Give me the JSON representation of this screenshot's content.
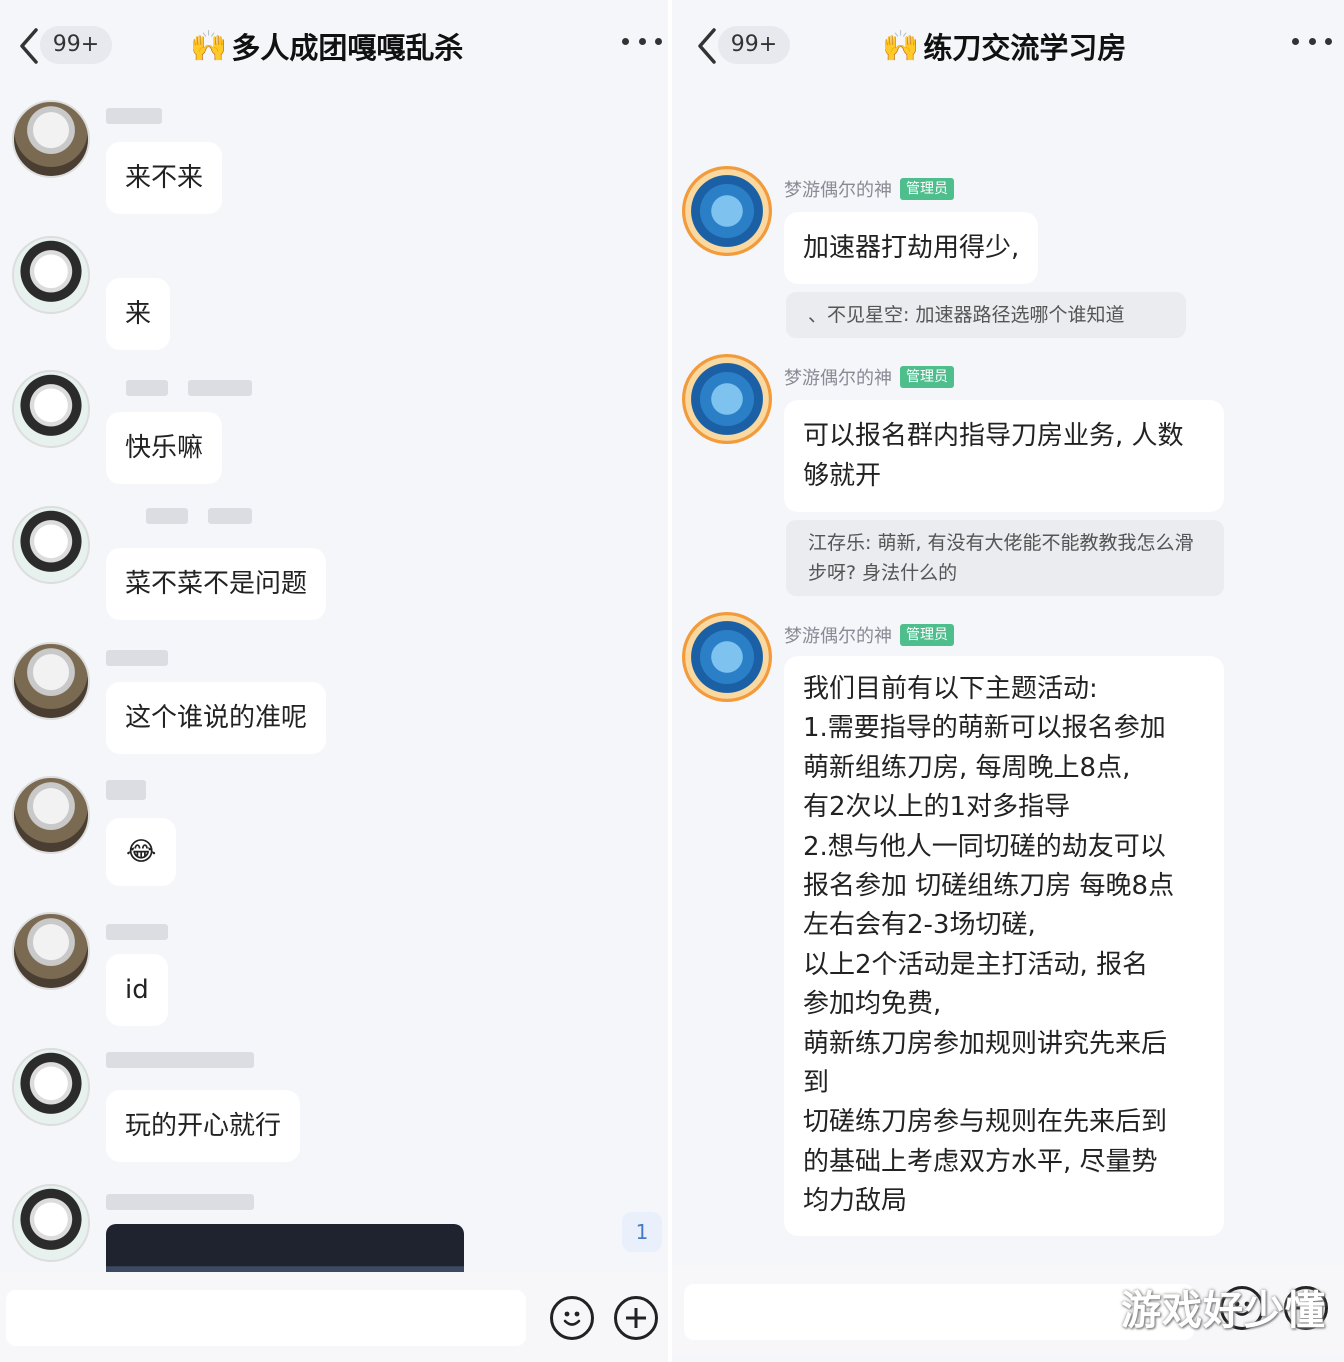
{
  "left_chat": {
    "unread_badge": "99+",
    "title_emoji": "🙌",
    "title": "多人成团嘎嘎乱杀",
    "messages": [
      {
        "text": "来不来"
      },
      {
        "text": "来"
      },
      {
        "text": "快乐嘛"
      },
      {
        "text": "菜不菜不是问题"
      },
      {
        "text": "这个谁说的准呢"
      },
      {
        "text": "😂"
      },
      {
        "text": "id"
      },
      {
        "text": "玩的开心就行"
      }
    ],
    "new_message_count": "1",
    "emoji_icon": "smiley-icon",
    "plus_icon": "plus-icon"
  },
  "right_chat": {
    "unread_badge": "99+",
    "title_emoji": "🙌",
    "title": "练刀交流学习房",
    "sender_name": "梦游偶尔的神",
    "admin_tag": "管理员",
    "messages": [
      {
        "text": "加速器打劫用得少,",
        "quote": "、不见星空: 加速器路径选哪个谁知道"
      },
      {
        "text": "可以报名群内指导刀房业务, 人数够就开",
        "quote": "江存乐: 萌新, 有没有大佬能不能教教我怎么滑步呀? 身法什么的"
      },
      {
        "lines": [
          "我们目前有以下主题活动:",
          "1.需要指导的萌新可以报名参加",
          "萌新组练刀房, 每周晚上8点,",
          "有2次以上的1对多指导",
          "2.想与他人一同切磋的劫友可以",
          "报名参加 切磋组练刀房 每晚8点",
          "左右会有2-3场切磋,",
          "以上2个活动是主打活动, 报名",
          "参加均免费,",
          "萌新练刀房参加规则讲究先来后",
          "到",
          "切磋练刀房参与规则在先来后到",
          "的基础上考虑双方水平, 尽量势",
          "均力敌局"
        ]
      }
    ]
  },
  "watermark": "游戏好少懂"
}
